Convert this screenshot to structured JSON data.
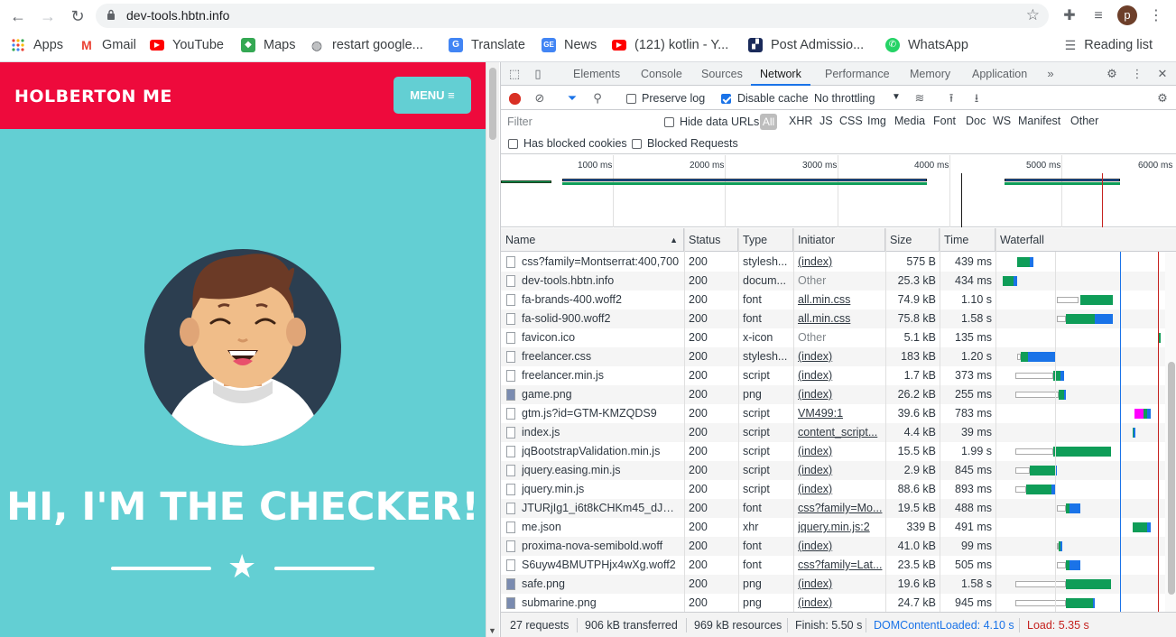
{
  "browser": {
    "url": "dev-tools.hbtn.info",
    "bookmarks": [
      {
        "label": "Apps",
        "icon": "apps-grid-icon"
      },
      {
        "label": "Gmail",
        "icon": "gmail-icon"
      },
      {
        "label": "YouTube",
        "icon": "youtube-icon"
      },
      {
        "label": "Maps",
        "icon": "maps-icon"
      },
      {
        "label": "restart google...",
        "icon": "globe-icon"
      },
      {
        "label": "Translate",
        "icon": "translate-icon"
      },
      {
        "label": "News",
        "icon": "news-icon"
      },
      {
        "label": "(121) kotlin - Y...",
        "icon": "youtube-icon"
      },
      {
        "label": "Post Admissio...",
        "icon": "bookmark-icon"
      },
      {
        "label": "WhatsApp",
        "icon": "whatsapp-icon"
      }
    ],
    "reading_list": "Reading list",
    "profile_initial": "p"
  },
  "site": {
    "brand": "HOLBERTON ME",
    "menu_label": "MENU",
    "hero": "HI, I'M THE CHECKER!",
    "colors": {
      "nav": "#ee0a3c",
      "bg": "#63cfd3",
      "avatar_bg": "#2c3e50"
    }
  },
  "devtools": {
    "tabs": [
      "Elements",
      "Console",
      "Sources",
      "Network",
      "Performance",
      "Memory",
      "Application"
    ],
    "active_tab": "Network",
    "toolbar": {
      "preserve_log": "Preserve log",
      "disable_cache": "Disable cache",
      "throttling": "No throttling"
    },
    "filter": {
      "placeholder": "Filter",
      "hide_data_urls": "Hide data URLs",
      "types": [
        "All",
        "XHR",
        "JS",
        "CSS",
        "Img",
        "Media",
        "Font",
        "Doc",
        "WS",
        "Manifest",
        "Other"
      ],
      "has_blocked_cookies": "Has blocked cookies",
      "blocked_requests": "Blocked Requests"
    },
    "overview_ticks": [
      "1000 ms",
      "2000 ms",
      "3000 ms",
      "4000 ms",
      "5000 ms",
      "6000 ms"
    ],
    "columns": [
      "Name",
      "Status",
      "Type",
      "Initiator",
      "Size",
      "Time",
      "Waterfall"
    ],
    "rows": [
      {
        "name": "css?family=Montserrat:400,700",
        "status": "200",
        "type": "stylesh...",
        "initiator": "(index)",
        "size": "575 B",
        "time": "439 ms"
      },
      {
        "name": "dev-tools.hbtn.info",
        "status": "200",
        "type": "docum...",
        "initiator": "Other",
        "size": "25.3 kB",
        "time": "434 ms"
      },
      {
        "name": "fa-brands-400.woff2",
        "status": "200",
        "type": "font",
        "initiator": "all.min.css",
        "size": "74.9 kB",
        "time": "1.10 s"
      },
      {
        "name": "fa-solid-900.woff2",
        "status": "200",
        "type": "font",
        "initiator": "all.min.css",
        "size": "75.8 kB",
        "time": "1.58 s"
      },
      {
        "name": "favicon.ico",
        "status": "200",
        "type": "x-icon",
        "initiator": "Other",
        "size": "5.1 kB",
        "time": "135 ms"
      },
      {
        "name": "freelancer.css",
        "status": "200",
        "type": "stylesh...",
        "initiator": "(index)",
        "size": "183 kB",
        "time": "1.20 s"
      },
      {
        "name": "freelancer.min.js",
        "status": "200",
        "type": "script",
        "initiator": "(index)",
        "size": "1.7 kB",
        "time": "373 ms"
      },
      {
        "name": "game.png",
        "status": "200",
        "type": "png",
        "initiator": "(index)",
        "size": "26.2 kB",
        "time": "255 ms"
      },
      {
        "name": "gtm.js?id=GTM-KMZQDS9",
        "status": "200",
        "type": "script",
        "initiator": "VM499:1",
        "size": "39.6 kB",
        "time": "783 ms"
      },
      {
        "name": "index.js",
        "status": "200",
        "type": "script",
        "initiator": "content_script...",
        "size": "4.4 kB",
        "time": "39 ms"
      },
      {
        "name": "jqBootstrapValidation.min.js",
        "status": "200",
        "type": "script",
        "initiator": "(index)",
        "size": "15.5 kB",
        "time": "1.99 s"
      },
      {
        "name": "jquery.easing.min.js",
        "status": "200",
        "type": "script",
        "initiator": "(index)",
        "size": "2.9 kB",
        "time": "845 ms"
      },
      {
        "name": "jquery.min.js",
        "status": "200",
        "type": "script",
        "initiator": "(index)",
        "size": "88.6 kB",
        "time": "893 ms"
      },
      {
        "name": "JTURjIg1_i6t8kCHKm45_dJE3...",
        "status": "200",
        "type": "font",
        "initiator": "css?family=Mo...",
        "size": "19.5 kB",
        "time": "488 ms"
      },
      {
        "name": "me.json",
        "status": "200",
        "type": "xhr",
        "initiator": "jquery.min.js:2",
        "size": "339 B",
        "time": "491 ms"
      },
      {
        "name": "proxima-nova-semibold.woff",
        "status": "200",
        "type": "font",
        "initiator": "(index)",
        "size": "41.0 kB",
        "time": "99 ms"
      },
      {
        "name": "S6uyw4BMUTPHjx4wXg.woff2",
        "status": "200",
        "type": "font",
        "initiator": "css?family=Lat...",
        "size": "23.5 kB",
        "time": "505 ms"
      },
      {
        "name": "safe.png",
        "status": "200",
        "type": "png",
        "initiator": "(index)",
        "size": "19.6 kB",
        "time": "1.58 s"
      },
      {
        "name": "submarine.png",
        "status": "200",
        "type": "png",
        "initiator": "(index)",
        "size": "24.7 kB",
        "time": "945 ms"
      }
    ],
    "status_bar": {
      "requests": "27 requests",
      "transferred": "906 kB transferred",
      "resources": "969 kB resources",
      "finish": "Finish: 5.50 s",
      "dcl": "DOMContentLoaded: 4.10 s",
      "load": "Load: 5.35 s"
    }
  }
}
